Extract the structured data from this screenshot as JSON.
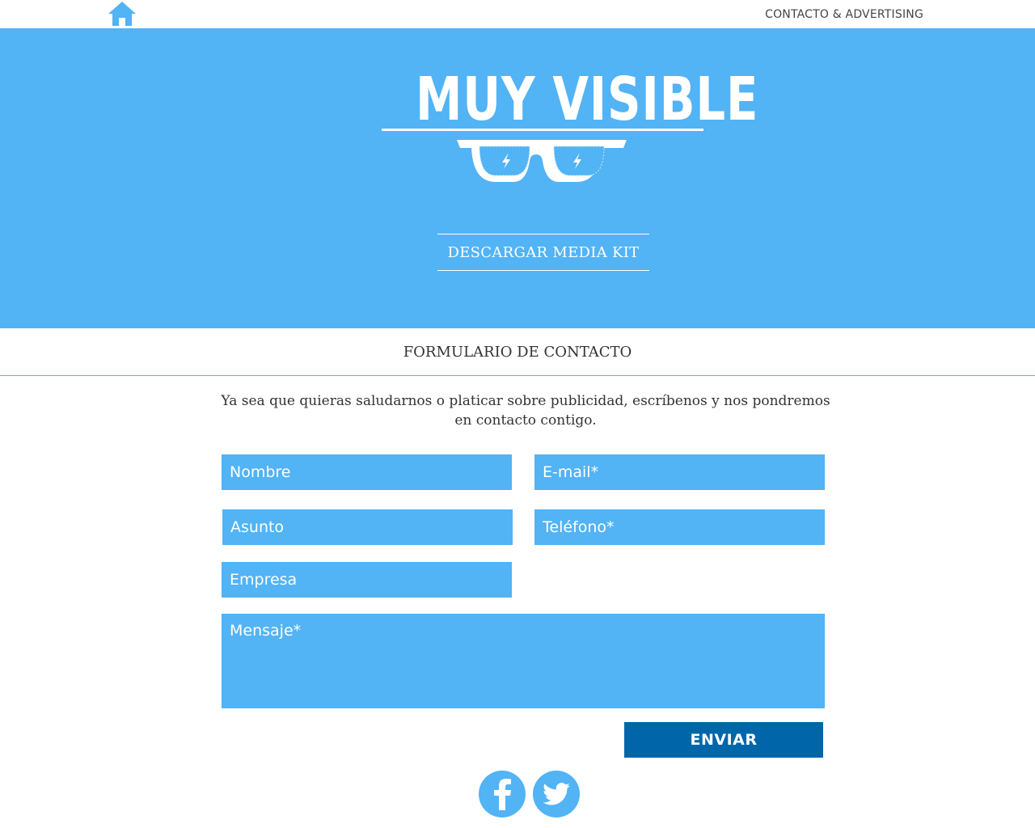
{
  "header": {
    "nav_link": "CONTACTO & ADVERTISING"
  },
  "hero": {
    "logo_text": "MUY VISIBLE",
    "media_kit_label": "DESCARGAR MEDIA KIT"
  },
  "contact": {
    "section_title": "FORMULARIO DE CONTACTO",
    "intro_line1": "Ya sea que quieras saludarnos o platicar sobre publicidad, escríbenos y nos pondremos",
    "intro_line2": "en contacto contigo.",
    "fields": {
      "name_placeholder": "Nombre",
      "email_placeholder": "E-mail*",
      "subject_placeholder": "Asunto",
      "phone_placeholder": "Teléfono*",
      "company_placeholder": "Empresa",
      "message_placeholder": "Mensaje*"
    },
    "submit_label": "ENVIAR"
  },
  "social": {
    "facebook_icon": "facebook-icon",
    "twitter_icon": "twitter-icon"
  },
  "colors": {
    "accent": "#52b3f5",
    "button": "#0066aa"
  }
}
